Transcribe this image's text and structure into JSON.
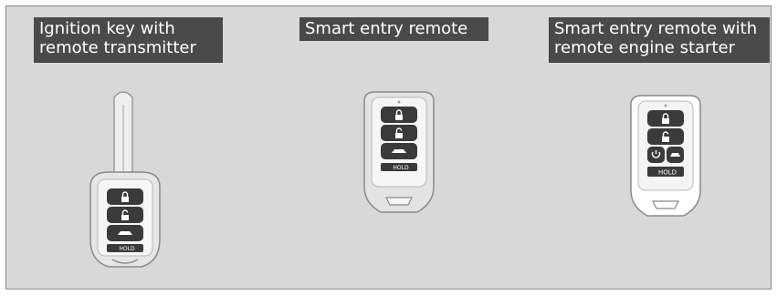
{
  "figures": [
    {
      "id": "ignition-key",
      "title_lines": [
        "Ignition key with",
        "remote transmitter"
      ],
      "buttons": [
        "lock-icon",
        "unlock-icon",
        "trunk-icon"
      ],
      "hold_label": "HOLD"
    },
    {
      "id": "smart-entry",
      "title_lines": [
        "Smart entry remote"
      ],
      "buttons": [
        "lock-icon",
        "unlock-icon",
        "trunk-icon"
      ],
      "hold_label": "HOLD"
    },
    {
      "id": "smart-entry-starter",
      "title_lines": [
        "Smart entry remote with",
        "remote engine starter"
      ],
      "buttons": [
        "lock-icon",
        "unlock-icon",
        "engine-start-icon",
        "trunk-icon"
      ],
      "hold_label": "HOLD"
    }
  ],
  "labels": {
    "ignition_key": "Ignition key with\nremote transmitter",
    "smart_entry": "Smart entry remote",
    "smart_entry_starter": "Smart entry remote with\nremote engine starter"
  },
  "colors": {
    "background": "#d8d8d8",
    "label_bg": "#4a4a4a",
    "label_text": "#ffffff",
    "fob_dark": "#3a3a3a",
    "fob_light": "#f2f2f2"
  }
}
